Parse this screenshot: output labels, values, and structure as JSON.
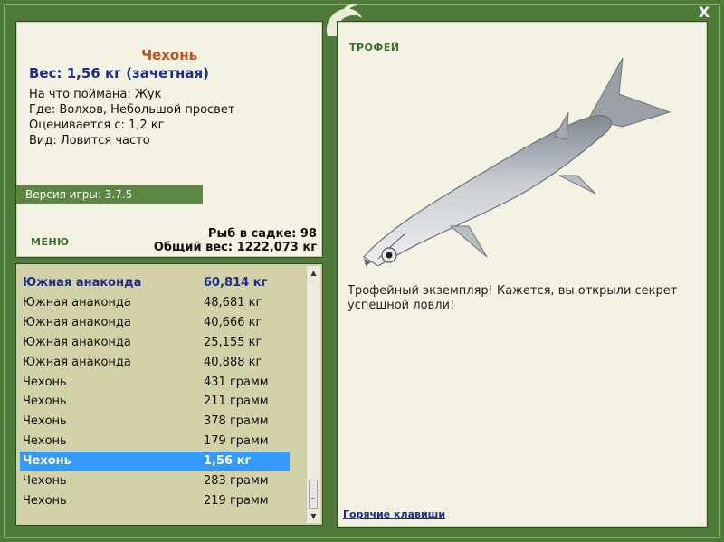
{
  "fish": {
    "name": "Чехонь",
    "weight": "Вес: 1,56 кг (зачетная)",
    "info": [
      "На что поймана: Жук",
      "Где: Волхов, Небольшой просвет",
      "Оценивается с: 1,2 кг",
      "Вид: Ловится часто"
    ]
  },
  "version": "Версия игры: 3.7.5",
  "menu_label": "МЕНЮ",
  "stats": {
    "count": "Рыб в садке: 98",
    "total": "Общий вес: 1222,073 кг"
  },
  "catch_list": [
    {
      "name": "Южная анаконда",
      "value": "60,814 кг",
      "style": "bold"
    },
    {
      "name": "Южная анаконда",
      "value": "48,681 кг",
      "style": ""
    },
    {
      "name": "Южная анаконда",
      "value": "40,666 кг",
      "style": ""
    },
    {
      "name": "Южная анаконда",
      "value": "25,155 кг",
      "style": ""
    },
    {
      "name": "Южная анаконда",
      "value": "40,888 кг",
      "style": ""
    },
    {
      "name": "Чехонь",
      "value": "431 грамм",
      "style": ""
    },
    {
      "name": "Чехонь",
      "value": "211 грамм",
      "style": ""
    },
    {
      "name": "Чехонь",
      "value": "378 грамм",
      "style": ""
    },
    {
      "name": "Чехонь",
      "value": "179 грамм",
      "style": ""
    },
    {
      "name": "Чехонь",
      "value": "1,56 кг",
      "style": "selected"
    },
    {
      "name": "Чехонь",
      "value": "283 грамм",
      "style": ""
    },
    {
      "name": "Чехонь",
      "value": "219 грамм",
      "style": ""
    }
  ],
  "scrollbar": {
    "up_icon": "chevron-up-icon",
    "down_icon": "chevron-down-icon"
  },
  "trophy": {
    "label": "ТРОФЕЙ",
    "text": "Трофейный экземпляр! Кажется, вы открыли секрет успешной ловли!",
    "image_icon": "fish-image"
  },
  "hotkeys_label": "Горячие клавиши",
  "close_label": "X",
  "colors": {
    "frame": "#4f7a3a",
    "panel": "#f3f2e3",
    "list_bg": "#d3d1a8",
    "fish_name": "#c0501c",
    "accent_blue": "#1d2d8c",
    "selection": "#3399ff"
  }
}
